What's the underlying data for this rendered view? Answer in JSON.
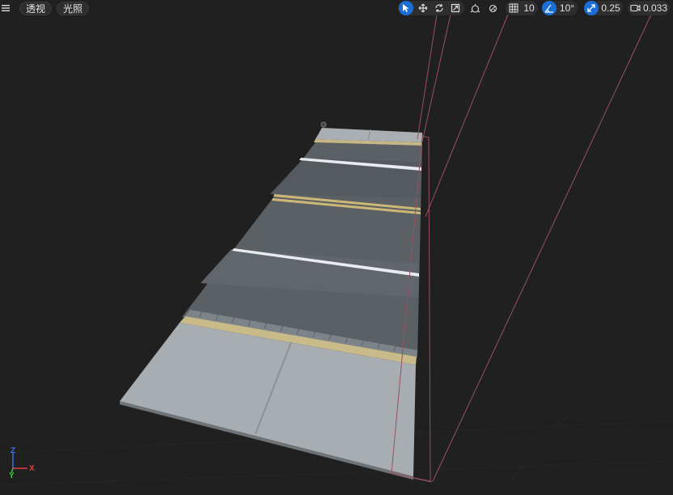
{
  "toolbar": {
    "menu_icon": "hamburger-icon",
    "view_mode": "透视",
    "lighting_mode": "光照",
    "transform_tools": [
      "select-icon",
      "move-icon",
      "rotate-icon",
      "scale-icon"
    ],
    "grid_snap": "10",
    "rotation_snap": "10°",
    "scale_snap": "0.25",
    "camera_speed": "0.033"
  },
  "axis_gizmo": {
    "x": "X",
    "y": "Y",
    "z": "Z"
  },
  "colors": {
    "background": "#202020",
    "accent": "#1a6fd6",
    "road": "#5a5f64",
    "sidewalk": "#a7adb1",
    "curb_line": "#c8b786",
    "frustum": "#9a5060"
  }
}
